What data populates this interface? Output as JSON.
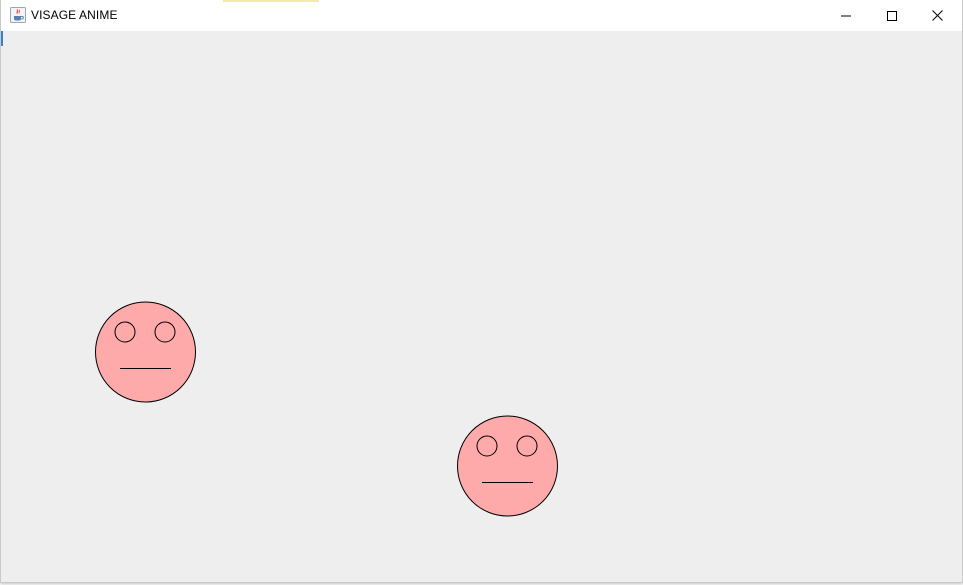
{
  "window": {
    "title": "VISAGE ANIME",
    "icon": "java-cup-icon",
    "controls": [
      "minimize-icon",
      "maximize-icon",
      "close-icon"
    ],
    "background_color": "#eeeeee"
  },
  "faces": [
    {
      "fill_color": "#ffaaaa",
      "outline_color": "#000000",
      "expression": "neutral"
    },
    {
      "fill_color": "#ffaaaa",
      "outline_color": "#000000",
      "expression": "neutral"
    }
  ]
}
